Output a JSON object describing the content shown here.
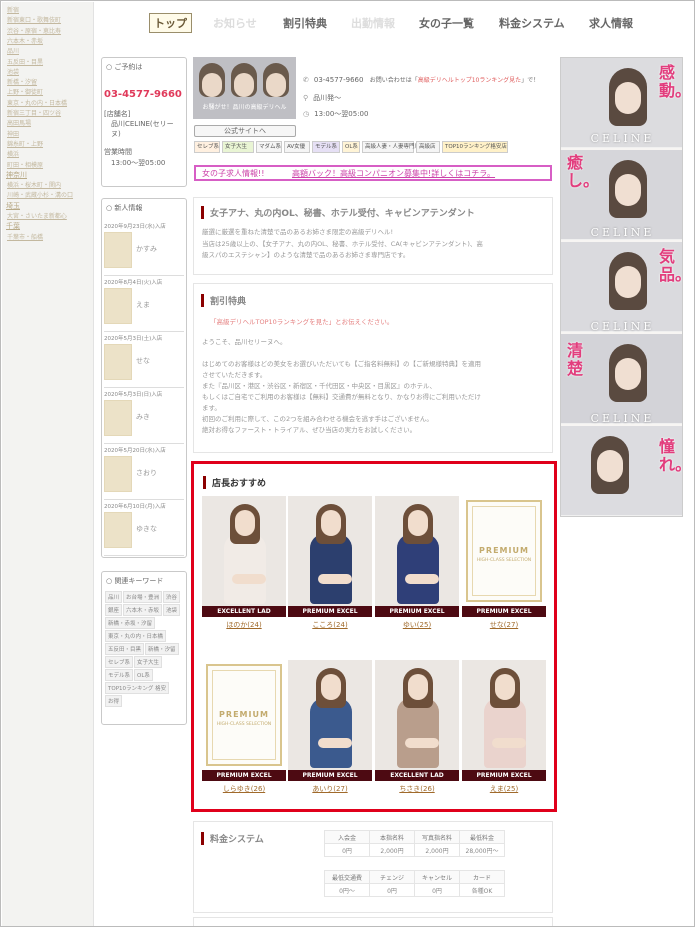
{
  "left_nav": [
    {
      "label": "新宿",
      "sec": false
    },
    {
      "label": "新宿東口・歌舞伎町",
      "sec": false
    },
    {
      "label": "渋谷・原宿・恵比寿",
      "sec": false
    },
    {
      "label": "六本木・赤坂",
      "sec": false
    },
    {
      "label": "品川",
      "sec": false
    },
    {
      "label": "五反田・目黒",
      "sec": false
    },
    {
      "label": "池袋",
      "sec": false
    },
    {
      "label": "新橋・汐留",
      "sec": false
    },
    {
      "label": "上野・御徒町",
      "sec": false
    },
    {
      "label": "東京・丸の内・日本橋",
      "sec": false
    },
    {
      "label": "新宿三丁目・四ツ谷",
      "sec": false
    },
    {
      "label": "高田馬場",
      "sec": false
    },
    {
      "label": "神田",
      "sec": false
    },
    {
      "label": "錦糸町・上野",
      "sec": false
    },
    {
      "label": "横浜",
      "sec": false
    },
    {
      "label": "町田・相模原",
      "sec": false
    },
    {
      "label": "神奈川",
      "sec": true
    },
    {
      "label": "横浜・桜木町・関内",
      "sec": false
    },
    {
      "label": "川崎・武蔵小杉・溝の口",
      "sec": false
    },
    {
      "label": "埼玉",
      "sec": true
    },
    {
      "label": "大宮・さいたま新都心",
      "sec": false
    },
    {
      "label": "千葉",
      "sec": true
    },
    {
      "label": "千葉市・船橋",
      "sec": false
    }
  ],
  "topnav": {
    "tabs": [
      {
        "label": "トップ",
        "style": "active"
      },
      {
        "label": "お知らせ",
        "style": "faint"
      },
      {
        "label": "割引特典",
        "style": "normal"
      },
      {
        "label": "出勤情報",
        "style": "faint"
      },
      {
        "label": "女の子一覧",
        "style": "normal"
      },
      {
        "label": "料金システム",
        "style": "normal"
      },
      {
        "label": "求人情報",
        "style": "normal"
      }
    ]
  },
  "reserve": {
    "header": "ご予約は",
    "phone": "03-4577-9660",
    "shop_label": "[店舗名]",
    "shop_name_1": "品川CELINE(セリー",
    "shop_name_2": "ヌ)",
    "hours_label": "営業時間",
    "hours": "13:00〜翌05:00"
  },
  "news": {
    "header": "新人情報",
    "items": [
      {
        "date": "2020年9月23日(水)入店",
        "name": "かすみ"
      },
      {
        "date": "2020年8月4日(火)入店",
        "name": "えま"
      },
      {
        "date": "2020年5月3日(土)入店",
        "name": "せな"
      },
      {
        "date": "2020年5月3日(日)入店",
        "name": "みき"
      },
      {
        "date": "2020年5月20日(水)入店",
        "name": "さおり"
      },
      {
        "date": "2020年6月10日(月)入店",
        "name": "ゆきな"
      }
    ]
  },
  "keywords": {
    "header": "関連キーワード",
    "items": [
      "品川",
      "お台場・豊洲",
      "渋谷",
      "銀座",
      "六本木・赤坂",
      "池袋",
      "新橋・赤坂・汐留",
      "東京・丸の内・日本橋",
      "五反田・目黒",
      "新橋・汐留",
      "セレブ系",
      "女子大生",
      "モデル系",
      "OL系",
      "TOP10ランキング 格安",
      "お得"
    ]
  },
  "banner": {
    "caption": "お騒がせ！品川の高級デリヘル"
  },
  "official_button": "公式サイトへ",
  "tags": [
    "セレブ系",
    "女子大生",
    "マダム系",
    "AV女優",
    "モデル系",
    "OL系",
    "高級人妻・人妻専門店",
    "高級店",
    "TOP10ランキング格安店"
  ],
  "contact": {
    "phone": "03-4577-9660",
    "inquiry_note": "お問い合わせは「",
    "inquiry_link": "高級デリヘルトップ10ランキング見た",
    "inquiry_end": "」で！",
    "area": "品川発〜",
    "hours": "13:00〜翌05:00"
  },
  "recruit_bar": {
    "title": "女の子求人情報!!",
    "link": "高額バック！高級コンパニオン募集中!詳しくはコチラ。"
  },
  "intro": {
    "title": "女子アナ、丸の内OL、秘書、ホテル受付、キャビンアテンダント",
    "line1": "厳選に厳選を重ねた清楚で品のあるお姉さま限定の高級デリヘル!",
    "line2": "当店は25歳以上の、【女子アナ、丸の内OL、秘書、ホテル受付、CA(キャビンアテンダント)、高",
    "line3": "級スパのエステシャン】のような清楚で品のあるお姉さま専門店です。"
  },
  "discount": {
    "title": "割引特典",
    "note": "「高級デリヘルTOP10ランキングを見た」とお伝えください。",
    "welcome": "ようこそ、品川セリーヌへ。",
    "p1": "はじめてのお客様はどの美女をお選びいただいても【ご指名料無料】の【ご新規様特典】を適用",
    "p2": "させていただきます。",
    "p3": "また『品川区・港区・渋谷区・新宿区・千代田区・中央区・目黒区』のホテル、",
    "p4": "もしくはご自宅でご利用のお客様は【無料】交通費が無料となり、かなりお得にご利用いただけ",
    "p5": "ます。",
    "p6": "初回のご利用に際して、この2つを組み合わせる機会を逃す手はございません。",
    "p7": "絶対お得なファースト・トライアル、ぜひ当店の実力をお試しください。"
  },
  "recommend": {
    "title": "店長おすすめ",
    "girls": [
      {
        "badge": "EXCELLENT LAD",
        "name": "ほのか(24)",
        "photo": true,
        "dress": "#f1ebe6"
      },
      {
        "badge": "PREMIUM EXCEL",
        "name": "こころ(24)",
        "photo": true,
        "dress": "#2c3f6e"
      },
      {
        "badge": "PREMIUM EXCEL",
        "name": "ゆい(25)",
        "photo": true,
        "dress": "#2f3f78"
      },
      {
        "badge": "PREMIUM EXCEL",
        "name": "せな(27)",
        "photo": false,
        "dress": ""
      },
      {
        "badge": "PREMIUM EXCEL",
        "name": "しらゆき(26)",
        "photo": false,
        "dress": ""
      },
      {
        "badge": "PREMIUM EXCEL",
        "name": "あいり(27)",
        "photo": true,
        "dress": "#3b5a8e"
      },
      {
        "badge": "EXCELLENT LAD",
        "name": "ちさき(26)",
        "photo": true,
        "dress": "#b99e8c"
      },
      {
        "badge": "PREMIUM EXCEL",
        "name": "えま(25)",
        "photo": true,
        "dress": "#ead3cd"
      }
    ],
    "premium_text": "PREMIUM",
    "premium_sub": "HIGH-CLASS SELECTION"
  },
  "price": {
    "title": "料金システム",
    "row1_head": [
      "入会金",
      "本指名料",
      "写真指名料",
      "最低料金"
    ],
    "row1_val": [
      "0円",
      "2,000円",
      "2,000円",
      "28,000円〜"
    ],
    "row2_head": [
      "最低交通費",
      "チェンジ",
      "キャンセル",
      "カード"
    ],
    "row2_val": [
      "0円〜",
      "0円",
      "0円",
      "各種OK"
    ]
  },
  "side_ad": {
    "copy1": "感動。",
    "copy2": "癒し。",
    "copy3": "気品。",
    "copy4": "清楚",
    "copy5": "憧れ。",
    "logo": "CELINE"
  },
  "colors": {
    "accent_red": "#e0001b",
    "pink": "#e23d7d",
    "dark_badge": "#4d0a12",
    "section_bar": "#8b0000"
  }
}
